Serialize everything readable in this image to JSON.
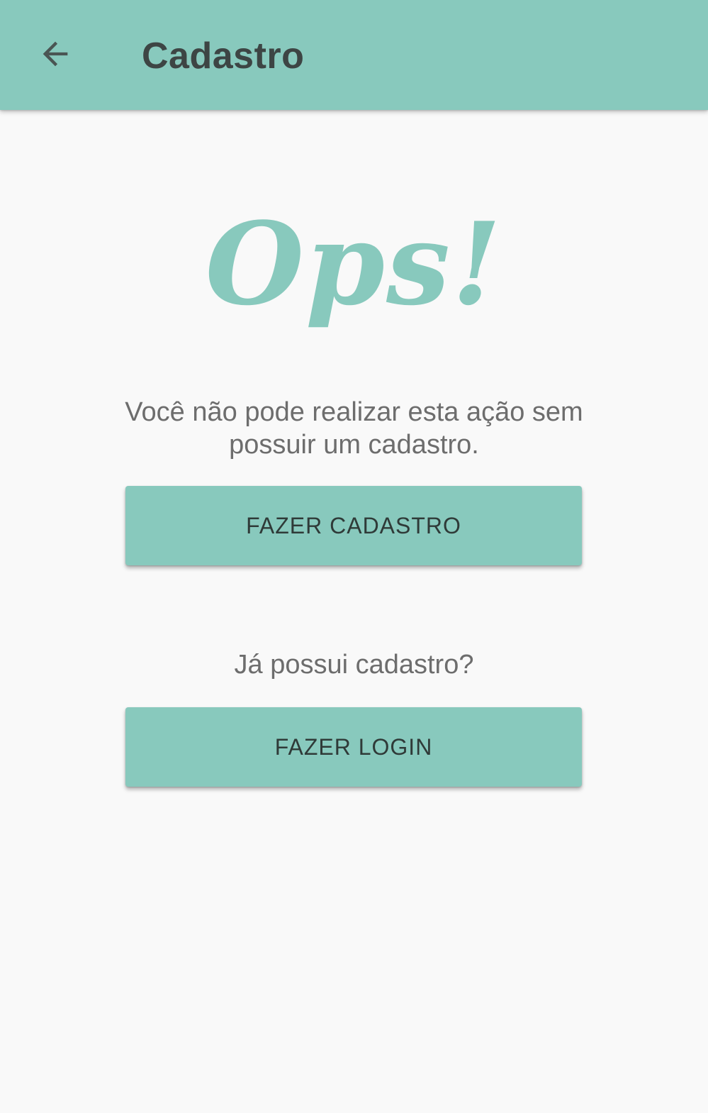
{
  "app_bar": {
    "title": "Cadastro",
    "back_icon": "arrow-back-icon"
  },
  "content": {
    "headline": "Ops!",
    "message": "Você não pode realizar esta ação sem possuir um cadastro.",
    "signup_button_label": "FAZER CADASTRO",
    "login_prompt": "Já possui cadastro?",
    "login_button_label": "FAZER LOGIN"
  },
  "colors": {
    "primary": "#88c9bd",
    "background": "#f9f9f9",
    "title_text": "#3d4544",
    "body_text": "#6d6d6d"
  }
}
